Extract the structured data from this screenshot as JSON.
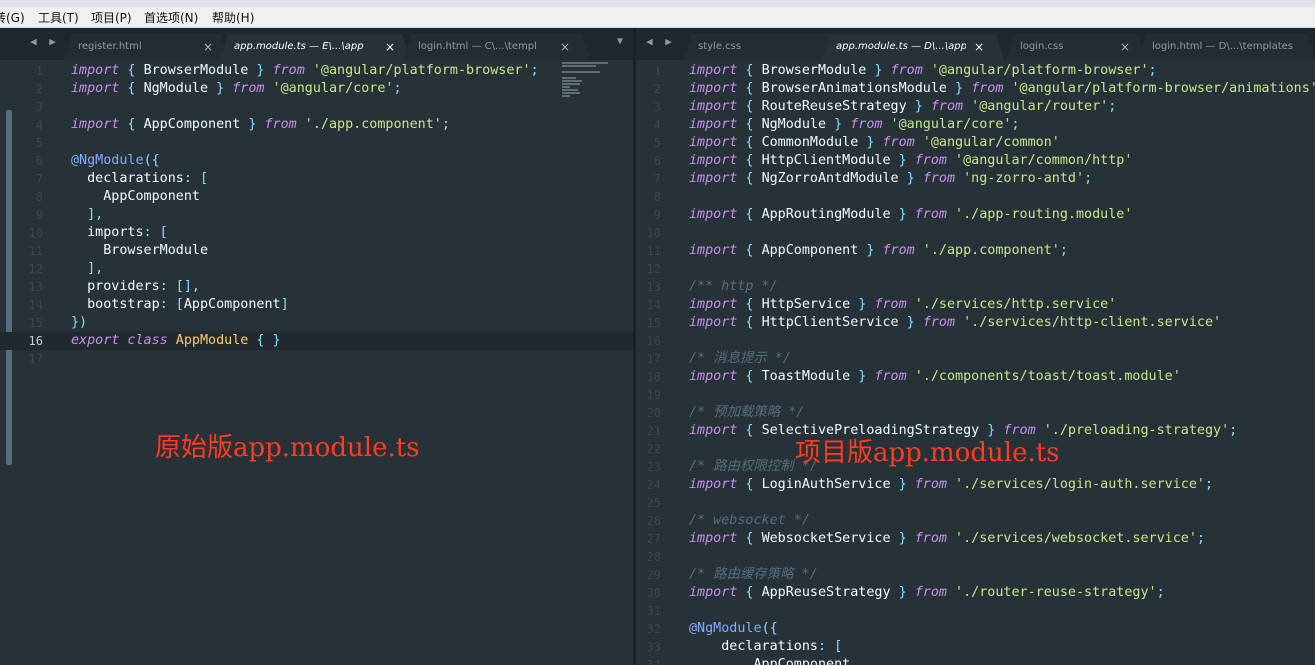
{
  "menu": [
    "转(G)",
    "工具(T)",
    "项目(P)",
    "首选项(N)",
    "帮助(H)"
  ],
  "left_tabs": [
    {
      "label": "register.html",
      "active": false
    },
    {
      "label": "app.module.ts — E\\...\\app",
      "active": true
    },
    {
      "label": "login.html — C\\...\\templ",
      "active": false
    }
  ],
  "right_tabs": [
    {
      "label": "style.css",
      "active": false
    },
    {
      "label": "app.module.ts — D\\...\\app",
      "active": true
    },
    {
      "label": "login.css",
      "active": false
    },
    {
      "label": "login.html — D\\...\\templates",
      "active": false
    }
  ],
  "left_code": [
    [
      [
        "kw",
        "import"
      ],
      [
        "pn",
        " { "
      ],
      [
        "id",
        "BrowserModule"
      ],
      [
        "pn",
        " } "
      ],
      [
        "kw",
        "from"
      ],
      [
        "str",
        " '@angular/platform-browser'"
      ],
      [
        "pn",
        ";"
      ]
    ],
    [
      [
        "kw",
        "import"
      ],
      [
        "pn",
        " { "
      ],
      [
        "id",
        "NgModule"
      ],
      [
        "pn",
        " } "
      ],
      [
        "kw",
        "from"
      ],
      [
        "str",
        " '@angular/core'"
      ],
      [
        "pn",
        ";"
      ]
    ],
    [],
    [
      [
        "kw",
        "import"
      ],
      [
        "pn",
        " { "
      ],
      [
        "id",
        "AppComponent"
      ],
      [
        "pn",
        " } "
      ],
      [
        "kw",
        "from"
      ],
      [
        "str",
        " './app.component'"
      ],
      [
        "pn",
        ";"
      ]
    ],
    [],
    [
      [
        "dec",
        "@NgModule"
      ],
      [
        "pn",
        "({"
      ]
    ],
    [
      [
        "id",
        "  declarations"
      ],
      [
        "pn",
        ": ["
      ]
    ],
    [
      [
        "id",
        "    AppComponent"
      ]
    ],
    [
      [
        "pn",
        "  ],"
      ]
    ],
    [
      [
        "id",
        "  imports"
      ],
      [
        "pn",
        ": ["
      ]
    ],
    [
      [
        "id",
        "    BrowserModule"
      ]
    ],
    [
      [
        "pn",
        "  ],"
      ]
    ],
    [
      [
        "id",
        "  providers"
      ],
      [
        "pn",
        ": [],"
      ]
    ],
    [
      [
        "id",
        "  bootstrap"
      ],
      [
        "pn",
        ": ["
      ],
      [
        "id",
        "AppComponent"
      ],
      [
        "pn",
        "]"
      ]
    ],
    [
      [
        "pn",
        "})"
      ]
    ],
    [
      [
        "kw",
        "export class"
      ],
      [
        "cls",
        " AppModule"
      ],
      [
        "pn",
        " { }"
      ]
    ],
    []
  ],
  "right_code": [
    [
      [
        "kw",
        "import"
      ],
      [
        "pn",
        " { "
      ],
      [
        "id",
        "BrowserModule"
      ],
      [
        "pn",
        " } "
      ],
      [
        "kw",
        "from"
      ],
      [
        "str",
        " '@angular/platform-browser'"
      ],
      [
        "pn",
        ";"
      ]
    ],
    [
      [
        "kw",
        "import"
      ],
      [
        "pn",
        " { "
      ],
      [
        "id",
        "BrowserAnimationsModule"
      ],
      [
        "pn",
        " } "
      ],
      [
        "kw",
        "from"
      ],
      [
        "str",
        " '@angular/platform-browser/animations'"
      ],
      [
        "pn",
        ";"
      ]
    ],
    [
      [
        "kw",
        "import"
      ],
      [
        "pn",
        " { "
      ],
      [
        "id",
        "RouteReuseStrategy"
      ],
      [
        "pn",
        " } "
      ],
      [
        "kw",
        "from"
      ],
      [
        "str",
        " '@angular/router'"
      ],
      [
        "pn",
        ";"
      ]
    ],
    [
      [
        "kw",
        "import"
      ],
      [
        "pn",
        " { "
      ],
      [
        "id",
        "NgModule"
      ],
      [
        "pn",
        " } "
      ],
      [
        "kw",
        "from"
      ],
      [
        "str",
        " '@angular/core'"
      ],
      [
        "pn",
        ";"
      ]
    ],
    [
      [
        "kw",
        "import"
      ],
      [
        "pn",
        " { "
      ],
      [
        "id",
        "CommonModule"
      ],
      [
        "pn",
        " } "
      ],
      [
        "kw",
        "from"
      ],
      [
        "str",
        " '@angular/common'"
      ]
    ],
    [
      [
        "kw",
        "import"
      ],
      [
        "pn",
        " { "
      ],
      [
        "id",
        "HttpClientModule"
      ],
      [
        "pn",
        " } "
      ],
      [
        "kw",
        "from"
      ],
      [
        "str",
        " '@angular/common/http'"
      ]
    ],
    [
      [
        "kw",
        "import"
      ],
      [
        "pn",
        " { "
      ],
      [
        "id",
        "NgZorroAntdModule"
      ],
      [
        "pn",
        " } "
      ],
      [
        "kw",
        "from"
      ],
      [
        "str",
        " 'ng-zorro-antd'"
      ],
      [
        "pn",
        ";"
      ]
    ],
    [],
    [
      [
        "kw",
        "import"
      ],
      [
        "pn",
        " { "
      ],
      [
        "id",
        "AppRoutingModule"
      ],
      [
        "pn",
        " } "
      ],
      [
        "kw",
        "from"
      ],
      [
        "str",
        " './app-routing.module'"
      ]
    ],
    [],
    [
      [
        "kw",
        "import"
      ],
      [
        "pn",
        " { "
      ],
      [
        "id",
        "AppComponent"
      ],
      [
        "pn",
        " } "
      ],
      [
        "kw",
        "from"
      ],
      [
        "str",
        " './app.component'"
      ],
      [
        "pn",
        ";"
      ]
    ],
    [],
    [
      [
        "cm",
        "/** http */"
      ]
    ],
    [
      [
        "kw",
        "import"
      ],
      [
        "pn",
        " { "
      ],
      [
        "id",
        "HttpService"
      ],
      [
        "pn",
        " } "
      ],
      [
        "kw",
        "from"
      ],
      [
        "str",
        " './services/http.service'"
      ]
    ],
    [
      [
        "kw",
        "import"
      ],
      [
        "pn",
        " { "
      ],
      [
        "id",
        "HttpClientService"
      ],
      [
        "pn",
        " } "
      ],
      [
        "kw",
        "from"
      ],
      [
        "str",
        " './services/http-client.service'"
      ]
    ],
    [],
    [
      [
        "cm",
        "/* 消息提示 */"
      ]
    ],
    [
      [
        "kw",
        "import"
      ],
      [
        "pn",
        " { "
      ],
      [
        "id",
        "ToastModule"
      ],
      [
        "pn",
        " } "
      ],
      [
        "kw",
        "from"
      ],
      [
        "str",
        " './components/toast/toast.module'"
      ]
    ],
    [],
    [
      [
        "cm",
        "/* 预加载策略 */"
      ]
    ],
    [
      [
        "kw",
        "import"
      ],
      [
        "pn",
        " { "
      ],
      [
        "id",
        "SelectivePreloadingStrategy"
      ],
      [
        "pn",
        " } "
      ],
      [
        "kw",
        "from"
      ],
      [
        "str",
        " './preloading-strategy'"
      ],
      [
        "pn",
        ";"
      ]
    ],
    [],
    [
      [
        "cm",
        "/* 路由权限控制 */"
      ]
    ],
    [
      [
        "kw",
        "import"
      ],
      [
        "pn",
        " { "
      ],
      [
        "id",
        "LoginAuthService"
      ],
      [
        "pn",
        " } "
      ],
      [
        "kw",
        "from"
      ],
      [
        "str",
        " './services/login-auth.service'"
      ],
      [
        "pn",
        ";"
      ]
    ],
    [],
    [
      [
        "cm",
        "/* websocket */"
      ]
    ],
    [
      [
        "kw",
        "import"
      ],
      [
        "pn",
        " { "
      ],
      [
        "id",
        "WebsocketService"
      ],
      [
        "pn",
        " } "
      ],
      [
        "kw",
        "from"
      ],
      [
        "str",
        " './services/websocket.service'"
      ],
      [
        "pn",
        ";"
      ]
    ],
    [],
    [
      [
        "cm",
        "/* 路由缓存策略 */"
      ]
    ],
    [
      [
        "kw",
        "import"
      ],
      [
        "pn",
        " { "
      ],
      [
        "id",
        "AppReuseStrategy"
      ],
      [
        "pn",
        " } "
      ],
      [
        "kw",
        "from"
      ],
      [
        "str",
        " './router-reuse-strategy'"
      ],
      [
        "pn",
        ";"
      ]
    ],
    [],
    [
      [
        "dec",
        "@NgModule"
      ],
      [
        "pn",
        "({"
      ]
    ],
    [
      [
        "id",
        "    declarations"
      ],
      [
        "pn",
        ": ["
      ]
    ],
    [
      [
        "id",
        "        AppComponent"
      ]
    ]
  ],
  "annotations": {
    "left": "原始版app.module.ts",
    "right": "项目版app.module.ts"
  },
  "tab_close_glyph": "×",
  "tab_nav_glyph": "◀ ▶",
  "tab_dropdown_glyph": "▼"
}
